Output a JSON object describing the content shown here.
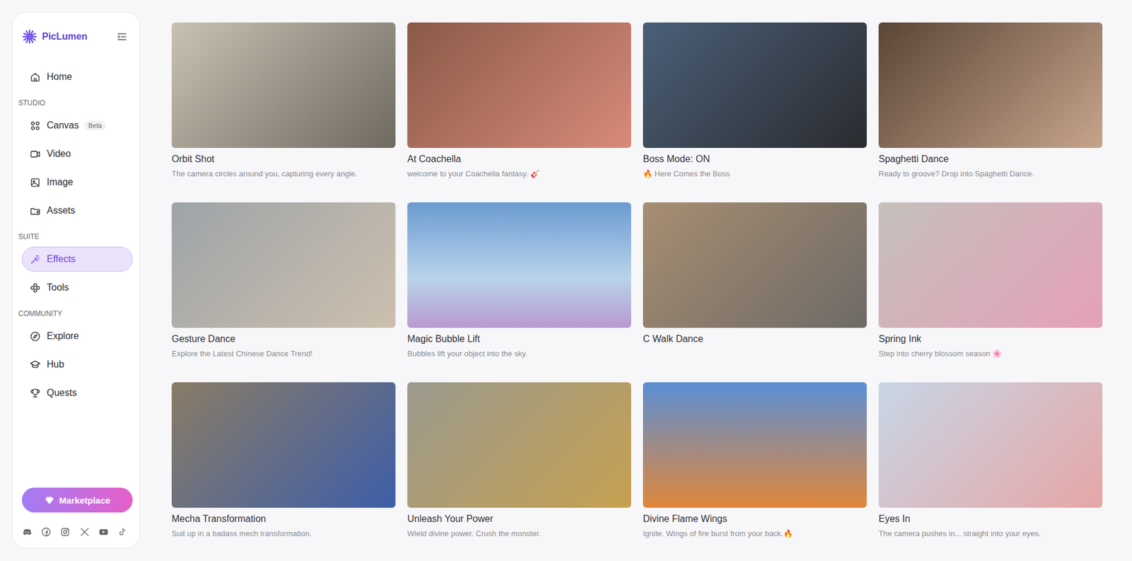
{
  "app": {
    "logo": "PicLumen"
  },
  "sidebar": {
    "sections": [
      {
        "label": "",
        "items": [
          {
            "label": "Home",
            "icon": "home",
            "badge": "",
            "selected": false
          }
        ]
      },
      {
        "label": "STUDIO",
        "items": [
          {
            "label": "Canvas",
            "icon": "canvas",
            "badge": "Beta",
            "selected": false
          },
          {
            "label": "Video",
            "icon": "video",
            "badge": "",
            "selected": false
          },
          {
            "label": "Image",
            "icon": "image",
            "badge": "",
            "selected": false
          },
          {
            "label": "Assets",
            "icon": "assets",
            "badge": "",
            "selected": false
          }
        ]
      },
      {
        "label": "SUITE",
        "items": [
          {
            "label": "Effects",
            "icon": "effects",
            "badge": "",
            "selected": true
          },
          {
            "label": "Tools",
            "icon": "tools",
            "badge": "",
            "selected": false
          }
        ]
      },
      {
        "label": "COMMUNITY",
        "items": [
          {
            "label": "Explore",
            "icon": "explore",
            "badge": "",
            "selected": false
          },
          {
            "label": "Hub",
            "icon": "hub",
            "badge": "",
            "selected": false
          },
          {
            "label": "Quests",
            "icon": "quests",
            "badge": "",
            "selected": false
          }
        ]
      }
    ],
    "marketplace": "Marketplace",
    "socials": [
      "discord",
      "facebook",
      "instagram",
      "x",
      "youtube",
      "tiktok"
    ]
  },
  "effects": [
    {
      "title": "Orbit Shot",
      "description": "The camera circles around you, capturing every angle."
    },
    {
      "title": "At Coachella",
      "description": "welcome to your Coachella fantasy. 🎸"
    },
    {
      "title": "Boss Mode: ON",
      "description": "🔥 Here Comes the Boss"
    },
    {
      "title": "Spaghetti Dance",
      "description": "Ready to groove? Drop into Spaghetti Dance."
    },
    {
      "title": "Gesture Dance",
      "description": "Explore the Latest Chinese Dance Trend!"
    },
    {
      "title": "Magic Bubble Lift",
      "description": "Bubbles lift your object into the sky."
    },
    {
      "title": "C Walk Dance",
      "description": ""
    },
    {
      "title": "Spring Ink",
      "description": "Step into cherry blossom season 🌸"
    },
    {
      "title": "Mecha Transformation",
      "description": "Suit up in a badass mech transformation."
    },
    {
      "title": "Unleash Your Power",
      "description": "Wield divine power. Crush the monster."
    },
    {
      "title": "Divine Flame Wings",
      "description": "Ignite. Wings of fire burst from your back.🔥"
    },
    {
      "title": "Eyes In",
      "description": "The camera pushes in... straight into your eyes."
    }
  ]
}
